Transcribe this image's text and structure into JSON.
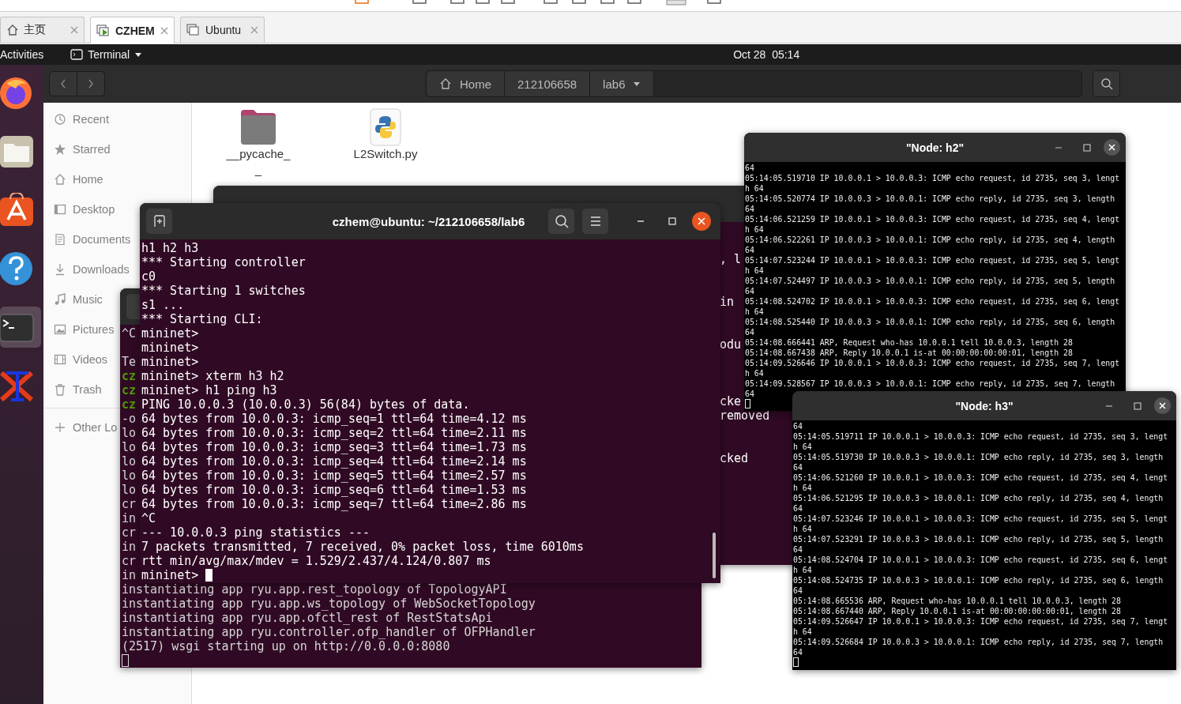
{
  "browser_tabs": [
    {
      "label": "主页",
      "kind": "home",
      "selected": false
    },
    {
      "label": "CZHEM",
      "kind": "vm_running",
      "selected": true
    },
    {
      "label": "Ubuntu",
      "kind": "vm",
      "selected": false
    }
  ],
  "top_bar": {
    "activities": "Activities",
    "app_menu": "Terminal",
    "clock": "Oct 28  05:14"
  },
  "dock": [
    {
      "kind": "browser",
      "selected": false
    },
    {
      "kind": "files",
      "selected": false
    },
    {
      "kind": "store",
      "selected": false
    },
    {
      "kind": "help",
      "selected": false
    },
    {
      "kind": "terminal",
      "selected": true
    },
    {
      "kind": "xapp",
      "selected": false
    }
  ],
  "files": {
    "path": [
      {
        "label": "Home",
        "kind": "home"
      },
      {
        "label": "212106658",
        "kind": "folder"
      },
      {
        "label": "lab6",
        "kind": "current"
      }
    ],
    "sidebar": [
      {
        "label": "Recent",
        "kind": "recent"
      },
      {
        "label": "Starred",
        "kind": "starred"
      },
      {
        "label": "Home",
        "kind": "home"
      },
      {
        "label": "Desktop",
        "kind": "desktop"
      },
      {
        "label": "Documents",
        "kind": "documents"
      },
      {
        "label": "Downloads",
        "kind": "downloads"
      },
      {
        "label": "Music",
        "kind": "music"
      },
      {
        "label": "Pictures",
        "kind": "pictures"
      },
      {
        "label": "Videos",
        "kind": "videos"
      },
      {
        "label": "Trash",
        "kind": "trash"
      },
      {
        "label": "Other Lo",
        "kind": "other"
      }
    ],
    "items": [
      {
        "kind": "folder",
        "name": [
          "__pycache_",
          "_"
        ]
      },
      {
        "kind": "python",
        "name": [
          "L2Switch.py"
        ]
      }
    ]
  },
  "terminals": [
    {
      "kind": "back",
      "fragments": [
        ", l",
        "in",
        "odu",
        "cke",
        "removed",
        "cked"
      ]
    },
    {
      "kind": "middle",
      "lines": [
        {
          "text": "^C",
          "kind": "output"
        },
        {
          "text": "Te",
          "kind": "output"
        },
        {
          "text": "cz",
          "kind": "prompt"
        },
        {
          "text": "cz",
          "kind": "prompt"
        },
        {
          "text": "cz",
          "kind": "prompt"
        },
        {
          "text": "-o",
          "kind": "output"
        },
        {
          "text": "lo",
          "kind": "output"
        },
        {
          "text": "lo",
          "kind": "output"
        },
        {
          "text": "lo",
          "kind": "output"
        },
        {
          "text": "lo",
          "kind": "output"
        },
        {
          "text": "lo",
          "kind": "output"
        },
        {
          "text": "cr",
          "kind": "output"
        },
        {
          "text": "in",
          "kind": "output"
        },
        {
          "text": "cr",
          "kind": "output"
        },
        {
          "text": "in",
          "kind": "output"
        },
        {
          "text": "cr",
          "kind": "output"
        },
        {
          "text": "in",
          "kind": "output"
        },
        {
          "text": "instantiating app ryu.app.rest_topology of TopologyAPI",
          "kind": "output"
        },
        {
          "text": "instantiating app ryu.app.ws_topology of WebSocketTopology",
          "kind": "output"
        },
        {
          "text": "instantiating app ryu.app.ofctl_rest of RestStatsApi",
          "kind": "output"
        },
        {
          "text": "instantiating app ryu.controller.ofp_handler of OFPHandler",
          "kind": "output"
        },
        {
          "text": "(2517) wsgi starting up on http://0.0.0.0:8080",
          "kind": "output"
        }
      ]
    },
    {
      "kind": "front",
      "title": "czhem@ubuntu: ~/212106658/lab6",
      "lines": [
        "h1 h2 h3",
        "*** Starting controller",
        "c0",
        "*** Starting 1 switches",
        "s1 ...",
        "*** Starting CLI:",
        "mininet>",
        "mininet>",
        "mininet>",
        "mininet> xterm h3 h2",
        "mininet> h1 ping h3",
        "PING 10.0.0.3 (10.0.0.3) 56(84) bytes of data.",
        "64 bytes from 10.0.0.3: icmp_seq=1 ttl=64 time=4.12 ms",
        "64 bytes from 10.0.0.3: icmp_seq=2 ttl=64 time=2.11 ms",
        "64 bytes from 10.0.0.3: icmp_seq=3 ttl=64 time=1.73 ms",
        "64 bytes from 10.0.0.3: icmp_seq=4 ttl=64 time=2.14 ms",
        "64 bytes from 10.0.0.3: icmp_seq=5 ttl=64 time=2.57 ms",
        "64 bytes from 10.0.0.3: icmp_seq=6 ttl=64 time=1.53 ms",
        "64 bytes from 10.0.0.3: icmp_seq=7 ttl=64 time=2.86 ms",
        "^C",
        "--- 10.0.0.3 ping statistics ---",
        "7 packets transmitted, 7 received, 0% packet loss, time 6010ms",
        "rtt min/avg/max/mdev = 1.529/2.437/4.124/0.807 ms",
        "mininet>"
      ]
    }
  ],
  "xterms": [
    {
      "title": "\"Node: h2\"",
      "lines": [
        "64",
        "05:14:05.519710 IP 10.0.0.1 > 10.0.0.3: ICMP echo request, id 2735, seq 3, lengt",
        "h 64",
        "05:14:05.520774 IP 10.0.0.3 > 10.0.0.1: ICMP echo reply, id 2735, seq 3, length",
        "64",
        "05:14:06.521259 IP 10.0.0.1 > 10.0.0.3: ICMP echo request, id 2735, seq 4, lengt",
        "h 64",
        "05:14:06.522261 IP 10.0.0.3 > 10.0.0.1: ICMP echo reply, id 2735, seq 4, length",
        "64",
        "05:14:07.523244 IP 10.0.0.1 > 10.0.0.3: ICMP echo request, id 2735, seq 5, lengt",
        "h 64",
        "05:14:07.524497 IP 10.0.0.3 > 10.0.0.1: ICMP echo reply, id 2735, seq 5, length",
        "64",
        "05:14:08.524702 IP 10.0.0.1 > 10.0.0.3: ICMP echo request, id 2735, seq 6, lengt",
        "h 64",
        "05:14:08.525440 IP 10.0.0.3 > 10.0.0.1: ICMP echo reply, id 2735, seq 6, length",
        "64",
        "05:14:08.666441 ARP, Request who-has 10.0.0.1 tell 10.0.0.3, length 28",
        "05:14:08.667438 ARP, Reply 10.0.0.1 is-at 00:00:00:00:00:01, length 28",
        "05:14:09.526646 IP 10.0.0.1 > 10.0.0.3: ICMP echo request, id 2735, seq 7, lengt",
        "h 64",
        "05:14:09.528567 IP 10.0.0.3 > 10.0.0.1: ICMP echo reply, id 2735, seq 7, length",
        "64"
      ]
    },
    {
      "title": "\"Node: h3\"",
      "lines": [
        "64",
        "05:14:05.519711 IP 10.0.0.1 > 10.0.0.3: ICMP echo request, id 2735, seq 3, lengt",
        "h 64",
        "05:14:05.519730 IP 10.0.0.3 > 10.0.0.1: ICMP echo reply, id 2735, seq 3, length",
        "64",
        "05:14:06.521260 IP 10.0.0.1 > 10.0.0.3: ICMP echo request, id 2735, seq 4, lengt",
        "h 64",
        "05:14:06.521295 IP 10.0.0.3 > 10.0.0.1: ICMP echo reply, id 2735, seq 4, length",
        "64",
        "05:14:07.523246 IP 10.0.0.1 > 10.0.0.3: ICMP echo request, id 2735, seq 5, lengt",
        "h 64",
        "05:14:07.523291 IP 10.0.0.3 > 10.0.0.1: ICMP echo reply, id 2735, seq 5, length",
        "64",
        "05:14:08.524704 IP 10.0.0.1 > 10.0.0.3: ICMP echo request, id 2735, seq 6, lengt",
        "h 64",
        "05:14:08.524735 IP 10.0.0.3 > 10.0.0.1: ICMP echo reply, id 2735, seq 6, length",
        "64",
        "05:14:08.665536 ARP, Request who-has 10.0.0.1 tell 10.0.0.3, length 28",
        "05:14:08.667440 ARP, Reply 10.0.0.1 is-at 00:00:00:00:00:01, length 28",
        "05:14:09.526647 IP 10.0.0.1 > 10.0.0.3: ICMP echo request, id 2735, seq 7, lengt",
        "h 64",
        "05:14:09.526684 IP 10.0.0.3 > 10.0.0.1: ICMP echo reply, id 2735, seq 7, length",
        "64"
      ]
    }
  ]
}
